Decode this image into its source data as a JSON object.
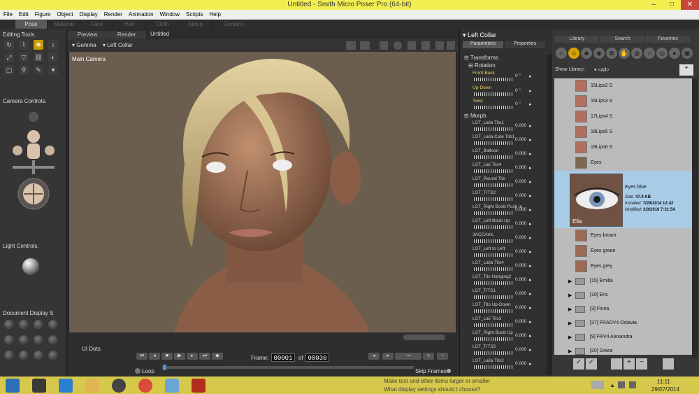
{
  "window": {
    "title": "Untitled - Smith Micro Poser Pro  (64-bit)"
  },
  "menu": [
    "File",
    "Edit",
    "Figure",
    "Object",
    "Display",
    "Render",
    "Animation",
    "Window",
    "Scripts",
    "Help"
  ],
  "rooms": [
    "Pose",
    "Material",
    "Face",
    "Hair",
    "Cloth",
    "Setup",
    "Content"
  ],
  "active_room": "Pose",
  "left_panel": {
    "editing_tools": "Editing Tools.",
    "camera_controls": "Camera Controls.",
    "light_controls": "Light Controls.",
    "document_display": "Document Display S",
    "ui_dots": "UI Dots."
  },
  "viewport": {
    "tabs": [
      "Preview",
      "Render"
    ],
    "doc_title": "Untitled",
    "figure_select": "Gemma",
    "actor_select": "Left Collar",
    "camera_label": "Main Camera"
  },
  "animation": {
    "loop_label": "Loop",
    "frame_label": "Frame:",
    "frame_current": "00001",
    "of_label": "of",
    "frame_total": "00030",
    "skip_frames": "Skip Frames"
  },
  "params": {
    "actor": "Left Collar",
    "tabs": [
      "Parameters",
      "Properties"
    ],
    "transforms_label": "Transforms",
    "rotation_label": "Rotation",
    "rotation": [
      {
        "label": "Front-Back",
        "value": "0 °"
      },
      {
        "label": "Up-Down",
        "value": "0 °"
      },
      {
        "label": "Twist",
        "value": "0 °"
      }
    ],
    "morph_label": "Morph",
    "morphs": [
      {
        "label": "LST_Laila Tits1",
        "value": "0.000"
      },
      {
        "label": "LST_Laila Cute Tits1",
        "value": "0.000"
      },
      {
        "label": "LST_Balloon",
        "value": "0.000"
      },
      {
        "label": "LST_Lali Tits4",
        "value": "0.000"
      },
      {
        "label": "LST_Round Tits",
        "value": "0.000"
      },
      {
        "label": "LST_TITS2",
        "value": "0.000"
      },
      {
        "label": "LST_Right Boob Push in",
        "value": "0.000"
      },
      {
        "label": "LST_Left Boob Up",
        "value": "0.000"
      },
      {
        "label": "3ACCAmL",
        "value": "0.000"
      },
      {
        "label": "LST_Left to Left",
        "value": "0.000"
      },
      {
        "label": "LST_Laila Tits4",
        "value": "0.000"
      },
      {
        "label": "LST_Tits Hanging2",
        "value": "0.000"
      },
      {
        "label": "LST_TITS1",
        "value": "0.000"
      },
      {
        "label": "LST_Tits Up-Down",
        "value": "0.000"
      },
      {
        "label": "LST_Lali Tits3",
        "value": "0.000"
      },
      {
        "label": "LST_Right Boob Up",
        "value": "0.000"
      },
      {
        "label": "LST_TITS5",
        "value": "0.000"
      },
      {
        "label": "LST_Laila Tits3",
        "value": "0.000"
      }
    ]
  },
  "library": {
    "tabs": [
      "Library",
      "Search",
      "Favorites"
    ],
    "show_library_label": "Show Library:",
    "show_library_value": "<All>",
    "items": [
      "15Lips2 S",
      "16Lips3 S",
      "17Lips4 S",
      "18Lips5 S",
      "19Lips6 S",
      "Eyes"
    ],
    "selected": {
      "name": "Eyes blue",
      "size_label": "Size:",
      "size": "47.9 KB",
      "installed_label": "Installed:",
      "installed": "7/29/2014 12:42",
      "modified_label": "Modified:",
      "modified": "3/3/2010 7:31:54",
      "thumb_caption": "Ella"
    },
    "items_after": [
      "Eyes brown",
      "Eyes green",
      "Eyes grey"
    ],
    "folders": [
      "[15]  Emilia",
      "[10]  Eris",
      "[3]   Fiona",
      "[37]  FRADV4 Octavia",
      "[9]   FRV4 Alexandra",
      "[20]  Grace"
    ]
  },
  "taskbar": {
    "tip1": "Make text and other items larger or smaller",
    "tip2": "What display settings should I choose?",
    "time": "11:11",
    "date": "29/07/2014"
  },
  "colors": {
    "accent": "#c89c00",
    "title_bar": "#f2ee4f",
    "taskbar": "#d5c84a",
    "selected_item": "#a8cbe6"
  }
}
